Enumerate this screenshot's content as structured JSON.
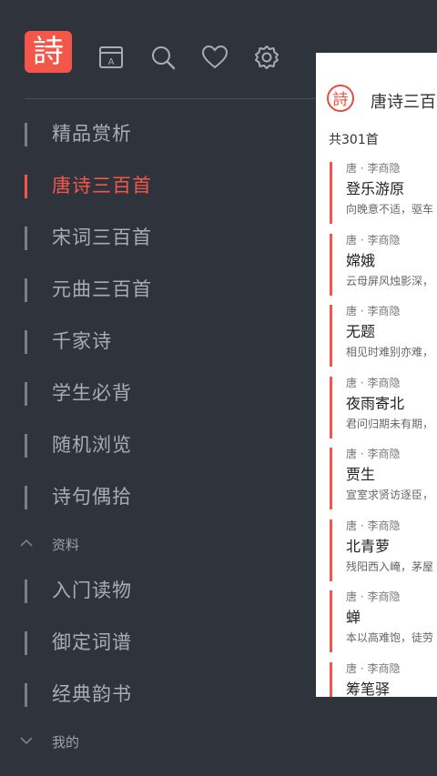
{
  "app": {
    "logo_char": "詩"
  },
  "toolbar": {
    "icons": [
      "calendar-icon",
      "search-icon",
      "heart-icon",
      "settings-icon"
    ]
  },
  "nav": {
    "items": [
      {
        "label": "精品赏析"
      },
      {
        "label": "唐诗三百首",
        "active": true
      },
      {
        "label": "宋词三百首"
      },
      {
        "label": "元曲三百首"
      },
      {
        "label": "千家诗"
      },
      {
        "label": "学生必背"
      },
      {
        "label": "随机浏览"
      },
      {
        "label": "诗句偶拾"
      }
    ],
    "section_resources": {
      "label": "资料",
      "items": [
        {
          "label": "入门读物"
        },
        {
          "label": "御定词谱"
        },
        {
          "label": "经典韵书"
        }
      ]
    },
    "section_mine": {
      "label": "我的"
    }
  },
  "panel": {
    "seal_char": "詩",
    "title": "唐诗三百首",
    "count": "共301首",
    "poems": [
      {
        "meta": "唐 · 李商隐",
        "title": "登乐游原",
        "excerpt": "向晚意不适，驱车"
      },
      {
        "meta": "唐 · 李商隐",
        "title": "嫦娥",
        "excerpt": "云母屏风烛影深，"
      },
      {
        "meta": "唐 · 李商隐",
        "title": "无题",
        "excerpt": "相见时难别亦难，"
      },
      {
        "meta": "唐 · 李商隐",
        "title": "夜雨寄北",
        "excerpt": "君问归期未有期，"
      },
      {
        "meta": "唐 · 李商隐",
        "title": "贾生",
        "excerpt": "宣室求贤访逐臣，"
      },
      {
        "meta": "唐 · 李商隐",
        "title": "北青萝",
        "excerpt": "残阳西入崦，茅屋"
      },
      {
        "meta": "唐 · 李商隐",
        "title": "蝉",
        "excerpt": "本以高难饱，徒劳"
      },
      {
        "meta": "唐 · 李商隐",
        "title": "筹笔驿",
        "excerpt": ""
      }
    ]
  },
  "colors": {
    "background": "#2f333b",
    "accent": "#f4564a",
    "text_muted": "#a9adb3"
  }
}
